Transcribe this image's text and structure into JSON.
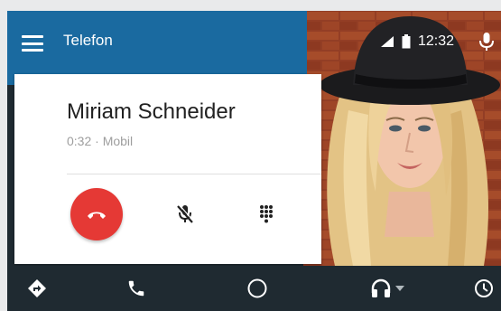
{
  "header": {
    "title": "Telefon",
    "menu_icon": "hamburger-menu-icon"
  },
  "status_bar": {
    "time": "12:32",
    "icons": [
      "signal-icon",
      "battery-icon",
      "microphone-icon"
    ]
  },
  "call": {
    "caller_name": "Miriam Schneider",
    "meta": "0:32 · Mobil",
    "actions": [
      "end-call-icon",
      "mic-off-icon",
      "dialpad-icon"
    ]
  },
  "nav": {
    "items": [
      "navigation-icon",
      "phone-icon",
      "home-icon",
      "headphones-icon",
      "recents-icon"
    ]
  },
  "colors": {
    "header": "#1a6aa0",
    "end_call": "#e53935",
    "navbar": "#1f2a31",
    "card": "#ffffff"
  }
}
